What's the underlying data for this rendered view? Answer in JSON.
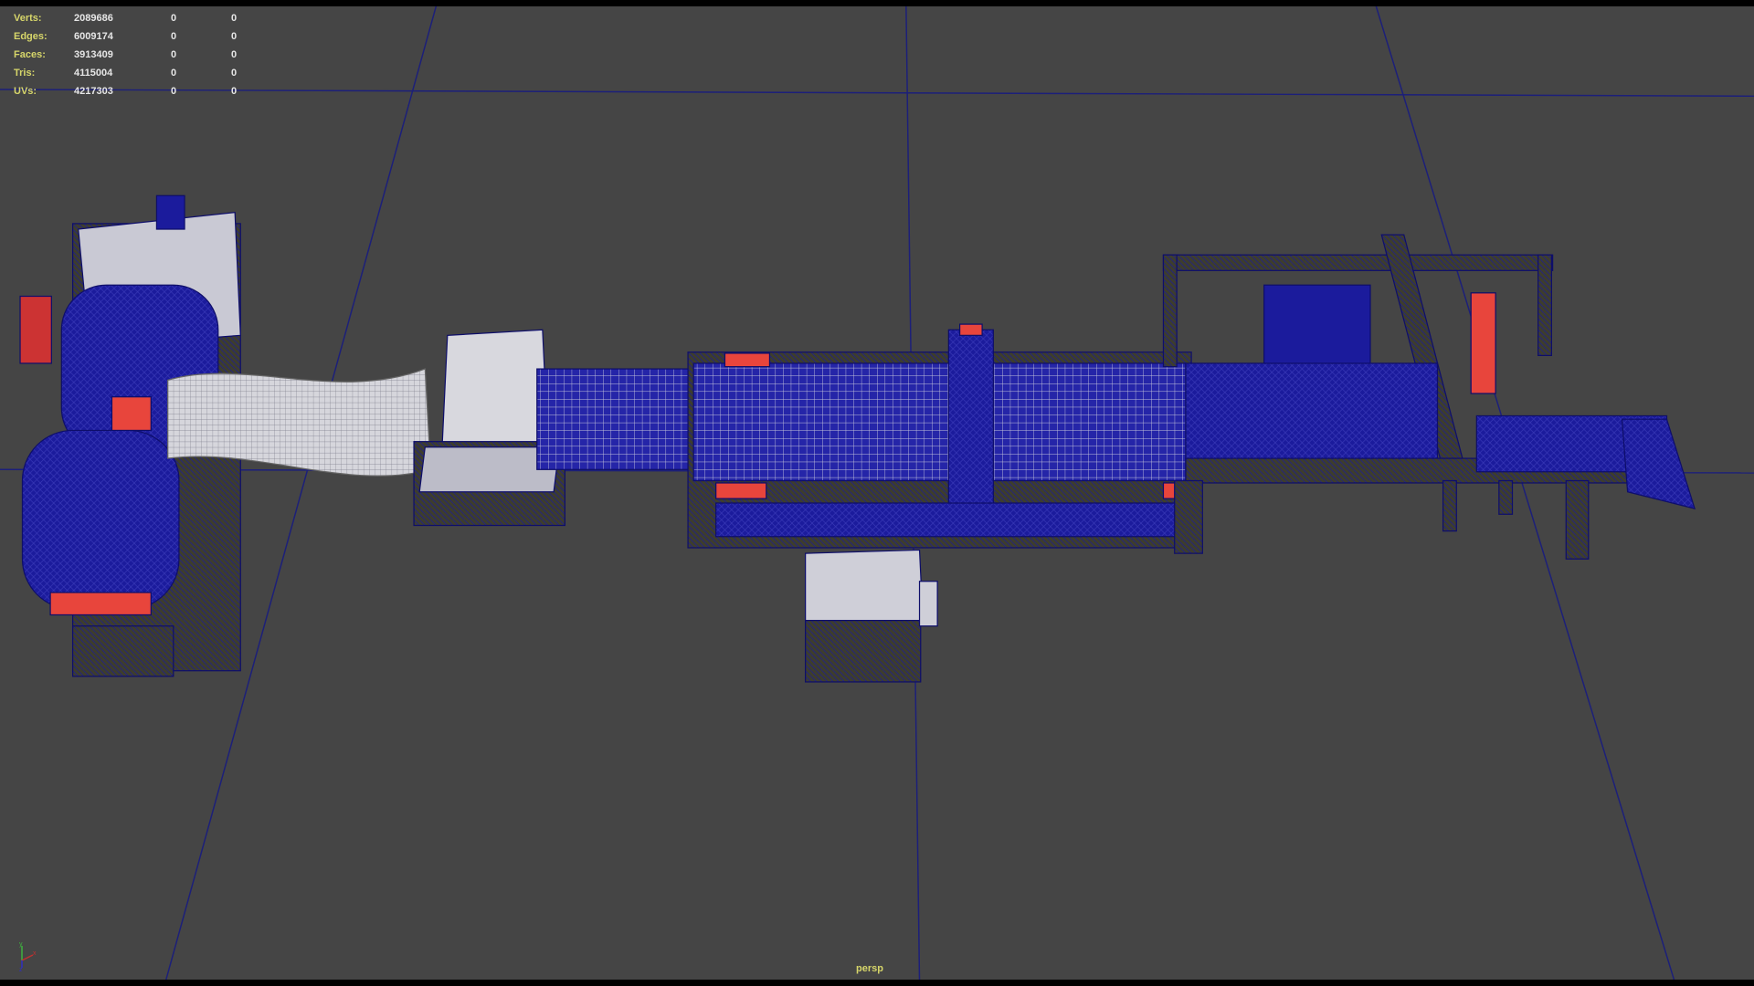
{
  "hud": {
    "rows": [
      {
        "label": "Verts:",
        "value": "2089686",
        "sel": "0",
        "extra": "0"
      },
      {
        "label": "Edges:",
        "value": "6009174",
        "sel": "0",
        "extra": "0"
      },
      {
        "label": "Faces:",
        "value": "3913409",
        "sel": "0",
        "extra": "0"
      },
      {
        "label": "Tris:",
        "value": "4115004",
        "sel": "0",
        "extra": "0"
      },
      {
        "label": "UVs:",
        "value": "4217303",
        "sel": "0",
        "extra": "0"
      }
    ]
  },
  "camera_label": "persp",
  "axis": {
    "y": "y",
    "x": "x",
    "z": "z"
  },
  "colors": {
    "background": "#454545",
    "grid": "#1c1f7a",
    "wire": "#1a1aa0",
    "accent": "#e8453c",
    "hud_label": "#d7d66a"
  }
}
